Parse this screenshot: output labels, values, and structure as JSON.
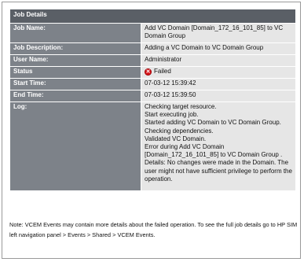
{
  "job_details": {
    "title": "Job Details",
    "rows": [
      {
        "label": "Job Name:",
        "value": "Add VC Domain [Domain_172_16_101_85] to VC Domain Group"
      },
      {
        "label": "Job Description:",
        "value": "Adding a VC Domain to VC Domain Group"
      },
      {
        "label": "User Name:",
        "value": "Administrator"
      },
      {
        "label": "Status",
        "value": "Failed",
        "icon": "error-x-icon",
        "icon_color": "#d8151a"
      },
      {
        "label": "Start Time:",
        "value": "07-03-12 15:39:42"
      },
      {
        "label": "End Time:",
        "value": "07-03-12 15:39:50"
      }
    ],
    "log": {
      "label": "Log:",
      "lines": [
        "Checking target resource.",
        "Start executing job.",
        "Started adding VC Domain to VC Domain Group.",
        "Checking dependencies.",
        "Validated VC Domain.",
        "Error during Add VC Domain",
        "[Domain_172_16_101_85] to VC Domain Group .",
        "Details: No changes were made in the Domain. The",
        "user might not have sufficient privilege to perform the",
        "operation."
      ]
    }
  },
  "note": "Note: VCEM Events may contain more details about the failed operation. To see the full job details go to HP SIM left navigation panel > Events > Shared > VCEM Events."
}
